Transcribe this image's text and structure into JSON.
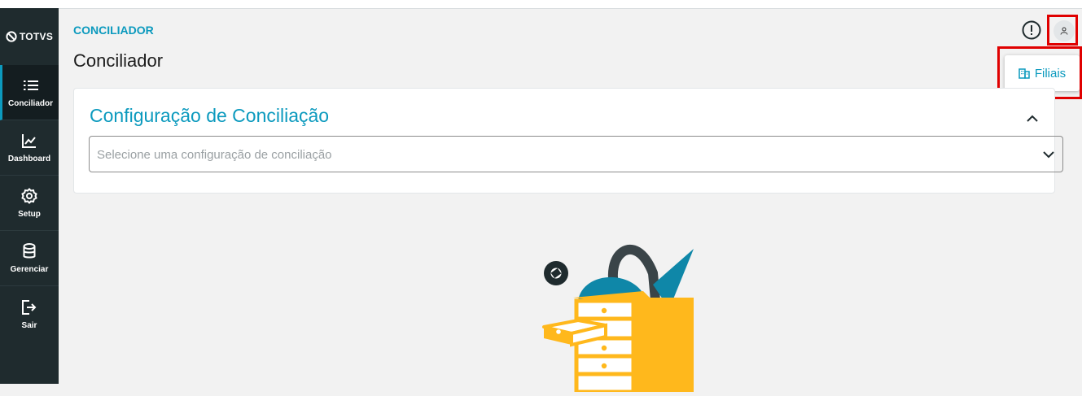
{
  "brand": {
    "name": "TOTVS"
  },
  "sidebar": {
    "items": [
      {
        "label": "Conciliador",
        "icon": "list-icon",
        "active": true
      },
      {
        "label": "Dashboard",
        "icon": "chart-icon",
        "active": false
      },
      {
        "label": "Setup",
        "icon": "gear-icon",
        "active": false
      },
      {
        "label": "Gerenciar",
        "icon": "database-icon",
        "active": false
      },
      {
        "label": "Sair",
        "icon": "logout-icon",
        "active": false
      }
    ]
  },
  "header": {
    "breadcrumb": "CONCILIADOR",
    "title": "Conciliador"
  },
  "user_menu": {
    "items": [
      {
        "label": "Filiais",
        "icon": "building-icon"
      }
    ]
  },
  "config_card": {
    "title": "Configuração de Conciliação",
    "select_placeholder": "Selecione uma configuração de conciliação"
  },
  "colors": {
    "accent": "#0c9abe",
    "sidebar_bg": "#1f2b2e",
    "highlight": "#e00000",
    "illustration_yellow": "#ffb81c",
    "illustration_teal": "#0f87a8"
  }
}
